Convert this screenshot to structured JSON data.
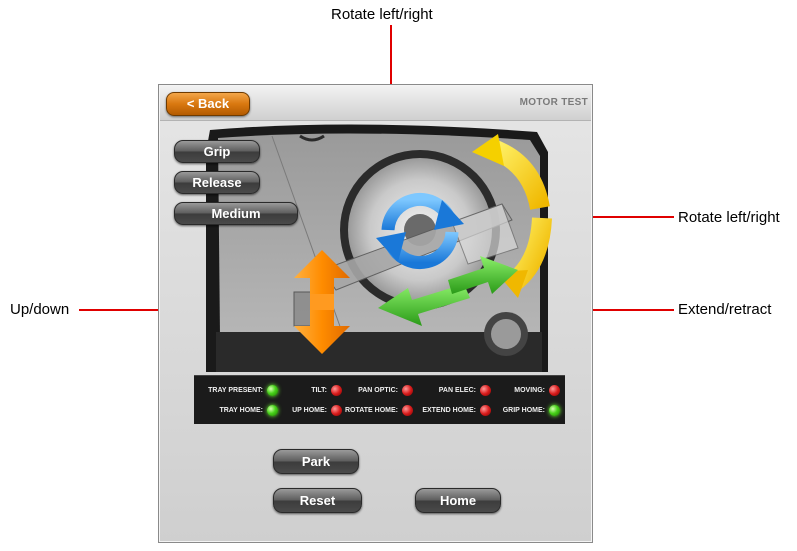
{
  "annotations": {
    "top": "Rotate left/right",
    "right_upper": "Rotate left/right",
    "left": "Up/down",
    "right_lower": "Extend/retract"
  },
  "colors": {
    "annotation_line": "#e00000",
    "back_button": "#d97810",
    "led_green": "#48d21a",
    "led_red": "#d91c1c",
    "rotate_arrow": "#2a8ee8",
    "rotate_outer_arrow": "#f5d000",
    "updown_arrow": "#ff8c00",
    "extend_arrow": "#3fc22a"
  },
  "header": {
    "back_label": "< Back",
    "title": "MOTOR TEST"
  },
  "grip_buttons": {
    "grip": "Grip",
    "release": "Release",
    "medium": "Medium"
  },
  "status": {
    "row1": [
      {
        "label": "TRAY PRESENT:",
        "state": "green"
      },
      {
        "label": "TILT:",
        "state": "red"
      },
      {
        "label": "PAN OPTIC:",
        "state": "red"
      },
      {
        "label": "PAN ELEC:",
        "state": "red"
      },
      {
        "label": "MOVING:",
        "state": "red"
      }
    ],
    "row2": [
      {
        "label": "TRAY HOME:",
        "state": "green"
      },
      {
        "label": "UP HOME:",
        "state": "red"
      },
      {
        "label": "ROTATE HOME:",
        "state": "red"
      },
      {
        "label": "EXTEND HOME:",
        "state": "red"
      },
      {
        "label": "GRIP HOME:",
        "state": "green"
      }
    ]
  },
  "actions": {
    "park": "Park",
    "reset": "Reset",
    "home": "Home"
  }
}
